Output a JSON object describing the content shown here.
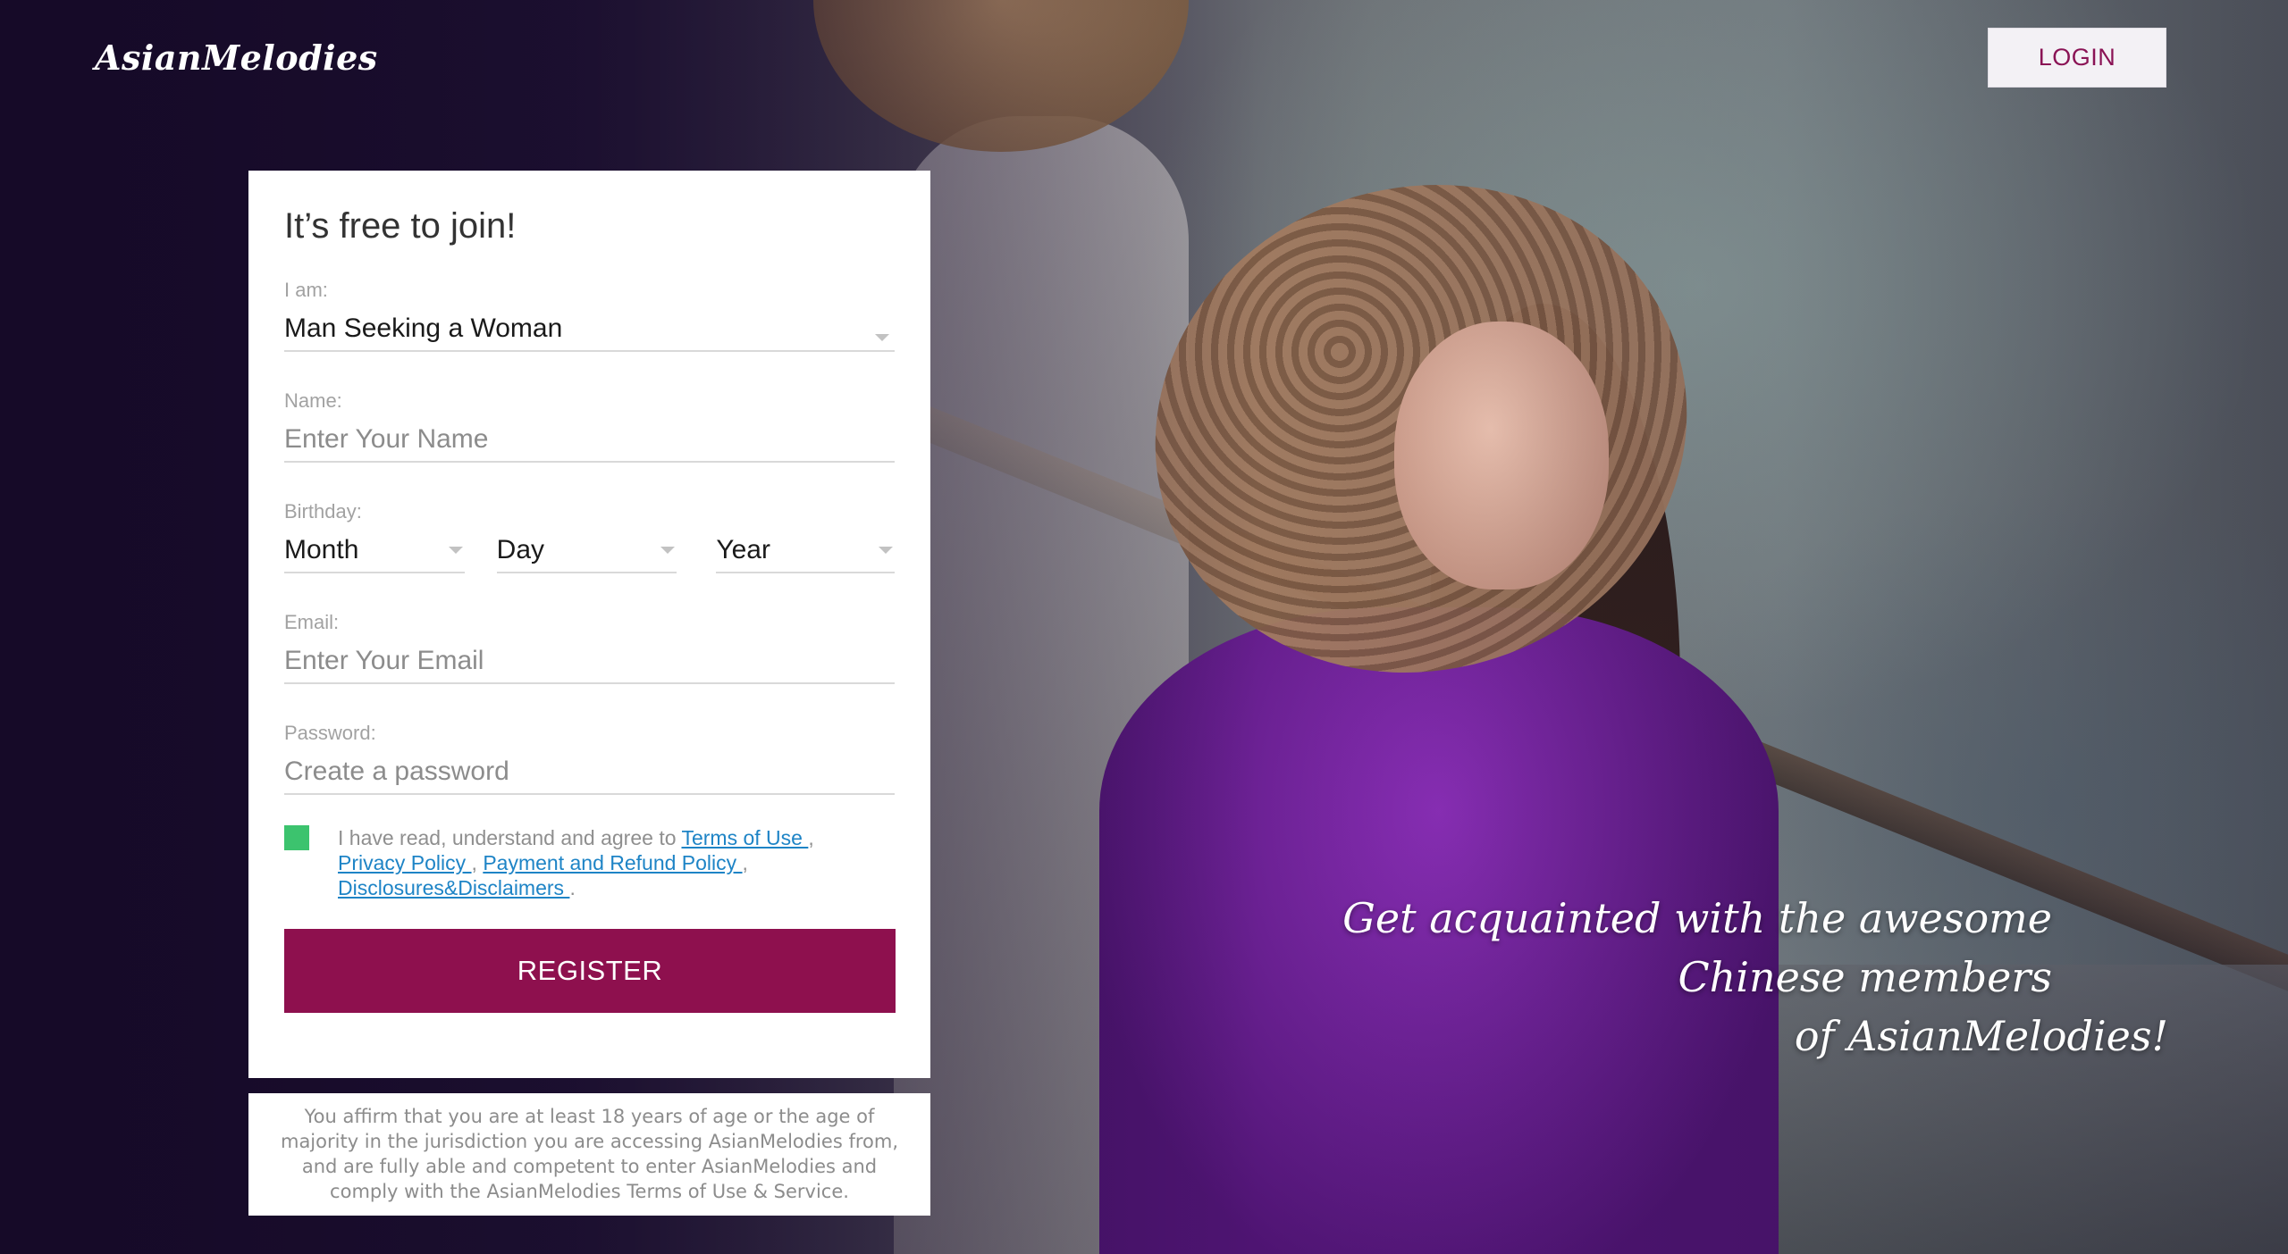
{
  "header": {
    "logo": "AsianMelodies",
    "login_label": "LOGIN"
  },
  "form": {
    "title": "It’s free to join!",
    "iam": {
      "label": "I am:",
      "value": "Man Seeking a Woman"
    },
    "name": {
      "label": "Name:",
      "placeholder": "Enter Your Name"
    },
    "birthday": {
      "label": "Birthday:",
      "month": "Month",
      "day": "Day",
      "year": "Year"
    },
    "email": {
      "label": "Email:",
      "placeholder": "Enter Your Email"
    },
    "password": {
      "label": "Password:",
      "placeholder": "Create a password"
    },
    "agree": {
      "text": "I have read, understand and agree to ",
      "terms": "Terms of Use ",
      "sep1": ",",
      "privacy": "Privacy Policy ",
      "sep2": ", ",
      "payment": "Payment and Refund Policy ",
      "sep3": ",",
      "disclosures": "Disclosures&Disclaimers ",
      "end": ".",
      "checked": true,
      "checkbox_color": "#3cc36e"
    },
    "register_label": "REGISTER"
  },
  "disclaimer": "You affirm that you are at least 18 years of age or the age of majority in the jurisdiction you are accessing AsianMelodies from, and are fully able and competent to enter AsianMelodies and comply with the AsianMelodies Terms of Use & Service.",
  "tagline": {
    "line1": "Get acquainted with the awesome Chinese members",
    "line2": "of AsianMelodies!"
  },
  "colors": {
    "brand": "#8e104e",
    "link": "#1e84c6",
    "background": "#1b0f2e"
  }
}
